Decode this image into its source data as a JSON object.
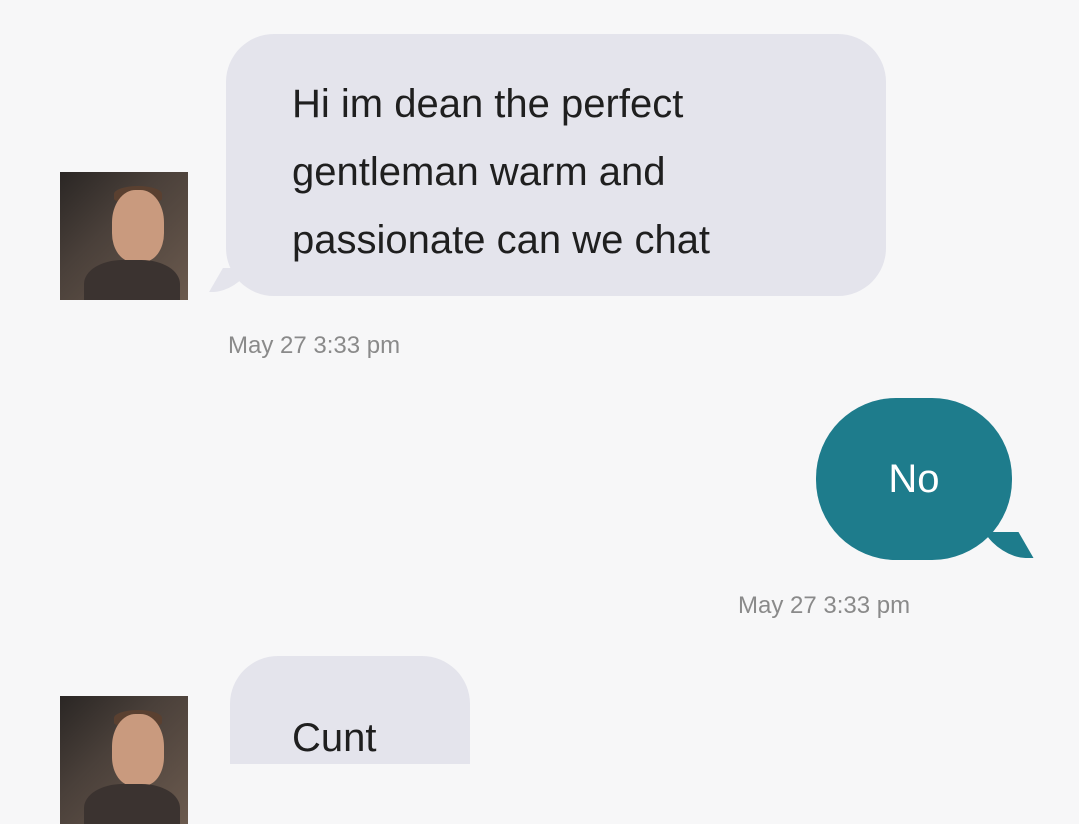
{
  "conversation": {
    "messages": [
      {
        "direction": "incoming",
        "text": "Hi im dean the perfect gentleman warm and passionate can we chat",
        "lines": [
          "Hi im dean the perfect",
          "gentleman warm and",
          "passionate can we chat"
        ],
        "timestamp": "May 27 3:33 pm"
      },
      {
        "direction": "outgoing",
        "text": "No",
        "timestamp": "May 27 3:33 pm"
      },
      {
        "direction": "incoming",
        "text": "Cunt"
      }
    ]
  },
  "colors": {
    "background": "#f7f7f8",
    "incoming_bubble": "#e4e4ec",
    "outgoing_bubble": "#1e7c8c",
    "timestamp": "#8a8a8a"
  },
  "icons": {
    "sender_avatar": "avatar-photo"
  }
}
